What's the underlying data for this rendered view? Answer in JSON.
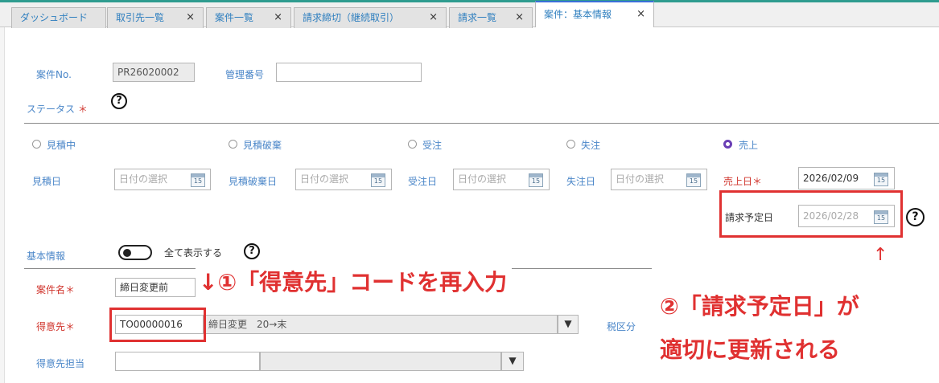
{
  "tabs": [
    {
      "label": "ダッシュボード",
      "closable": false
    },
    {
      "label": "取引先一覧",
      "closable": true
    },
    {
      "label": "案件一覧",
      "closable": true
    },
    {
      "label": "請求締切（継続取引）",
      "closable": true
    },
    {
      "label": "請求一覧",
      "closable": true
    },
    {
      "label": "案件：基本情報",
      "closable": true,
      "active": true
    }
  ],
  "close_glyph": "×",
  "form": {
    "case_no_label": "案件No.",
    "case_no_value": "PR26020002",
    "mgmt_no_label": "管理番号",
    "mgmt_no_value": "",
    "status_label": "ステータス",
    "required_mark": "＊",
    "statuses": [
      "見積中",
      "見積破棄",
      "受注",
      "失注",
      "売上"
    ],
    "selected_status": "売上",
    "estimate_date_label": "見積日",
    "discard_date_label": "見積破棄日",
    "order_date_label": "受注日",
    "lost_date_label": "失注日",
    "sales_date_label": "売上日",
    "date_placeholder": "日付の選択",
    "sales_date_value": "2026/02/09",
    "billing_date_label": "請求予定日",
    "billing_date_value": "2026/02/28",
    "calendar_day": "15",
    "basic_info_label": "基本情報",
    "show_all_label": "全て表示する",
    "case_name_label": "案件名",
    "case_name_value": "締日変更前",
    "customer_label": "得意先",
    "customer_code": "TO00000016",
    "customer_name": "締日変更　20→末",
    "tax_label": "税区分",
    "customer_contact_label": "得意先担当",
    "dropdown_glyph": "▼",
    "help_glyph": "?"
  },
  "annotations": {
    "step1": "↓①「得意先」コードを再入力",
    "arrow_up": "↑",
    "step2_line1": "②「請求予定日」が",
    "step2_line2": "適切に更新される",
    "color": "#e03131"
  }
}
